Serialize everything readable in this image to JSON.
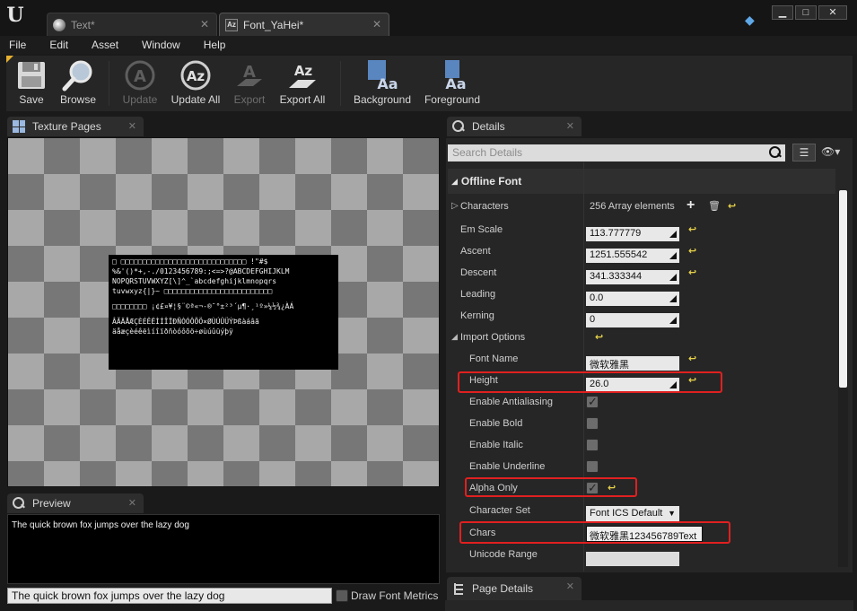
{
  "titlebar": {
    "tabs": [
      {
        "label": "Text*",
        "icon": "material-sphere-icon"
      },
      {
        "label": "Font_YaHei*",
        "icon": "font-asset-icon"
      }
    ],
    "window_buttons": {
      "minimize": "▁",
      "maximize": "□",
      "close": "✕"
    }
  },
  "menu": [
    "File",
    "Edit",
    "Asset",
    "Window",
    "Help"
  ],
  "toolbar": [
    {
      "label": "Save",
      "icon": "floppy-disk-icon",
      "enabled": true
    },
    {
      "label": "Browse",
      "icon": "magnifier-icon",
      "enabled": true
    },
    {
      "label": "Update",
      "icon": "font-update-icon",
      "enabled": false
    },
    {
      "label": "Update All",
      "icon": "font-update-all-icon",
      "enabled": true
    },
    {
      "label": "Export",
      "icon": "font-export-icon",
      "enabled": false
    },
    {
      "label": "Export All",
      "icon": "font-export-all-icon",
      "enabled": true
    },
    {
      "label": "Background",
      "icon": "background-color-icon",
      "enabled": true
    },
    {
      "label": "Foreground",
      "icon": "foreground-color-icon",
      "enabled": true
    }
  ],
  "texture_pages": {
    "tab_label": "Texture Pages",
    "atlas_lines": [
      "□ □□□□□□□□□□□□□□□□□□□□□□□□□□□□□ !\"#$",
      "%&'()*+,-./0123456789:;<=>?@ABCDEFGHIJKLM",
      "NOPQRSTUVWXYZ[\\]^_`abcdefghijklmnopqrs",
      "tuvwxyz{|}~ □□□□□□□□□□□□□□□□□□□□□□□□□",
      "□□□□□□□□ ¡¢£¤¥¦§¨©ª«¬-®¯°±²³´µ¶·¸¹º»¼½¾¿ÀÁ",
      "ÂÃÄÅÆÇÈÉÊËÌÍÎÏÐÑÒÓÔÕÖ×ØÙÚÛÜÝÞßàáâã",
      "äåæçèéêëìíîïðñòóôõö÷øùúûüýþÿ"
    ]
  },
  "preview": {
    "tab_label": "Preview",
    "text": "The quick brown fox jumps over the lazy dog",
    "input_value": "The quick brown fox jumps over the lazy dog",
    "draw_metrics_label": "Draw Font Metrics",
    "draw_metrics_checked": false
  },
  "details": {
    "tab_label": "Details",
    "search_placeholder": "Search Details",
    "section_title": "Offline Font",
    "characters": {
      "label": "Characters",
      "value": "256 Array elements"
    },
    "em_scale": {
      "label": "Em Scale",
      "value": "113.777779"
    },
    "ascent": {
      "label": "Ascent",
      "value": "1251.555542"
    },
    "descent": {
      "label": "Descent",
      "value": "341.333344"
    },
    "leading": {
      "label": "Leading",
      "value": "0.0"
    },
    "kerning": {
      "label": "Kerning",
      "value": "0"
    },
    "import_options": {
      "label": "Import Options"
    },
    "font_name": {
      "label": "Font Name",
      "value": "微软雅黑"
    },
    "height": {
      "label": "Height",
      "value": "26.0"
    },
    "enable_antialiasing": {
      "label": "Enable Antialiasing",
      "checked": true
    },
    "enable_bold": {
      "label": "Enable Bold",
      "checked": false
    },
    "enable_italic": {
      "label": "Enable Italic",
      "checked": false
    },
    "enable_underline": {
      "label": "Enable Underline",
      "checked": false
    },
    "alpha_only": {
      "label": "Alpha Only",
      "checked": true
    },
    "character_set": {
      "label": "Character Set",
      "value": "Font ICS Default"
    },
    "chars": {
      "label": "Chars",
      "value": "微软雅黑123456789Text"
    },
    "unicode_range": {
      "label": "Unicode Range",
      "value": ""
    }
  },
  "page_details": {
    "tab_label": "Page Details"
  },
  "colors": {
    "highlight": "#e02020",
    "reset_arrow": "#e8d24a",
    "accent_corner": "#e6b030"
  }
}
